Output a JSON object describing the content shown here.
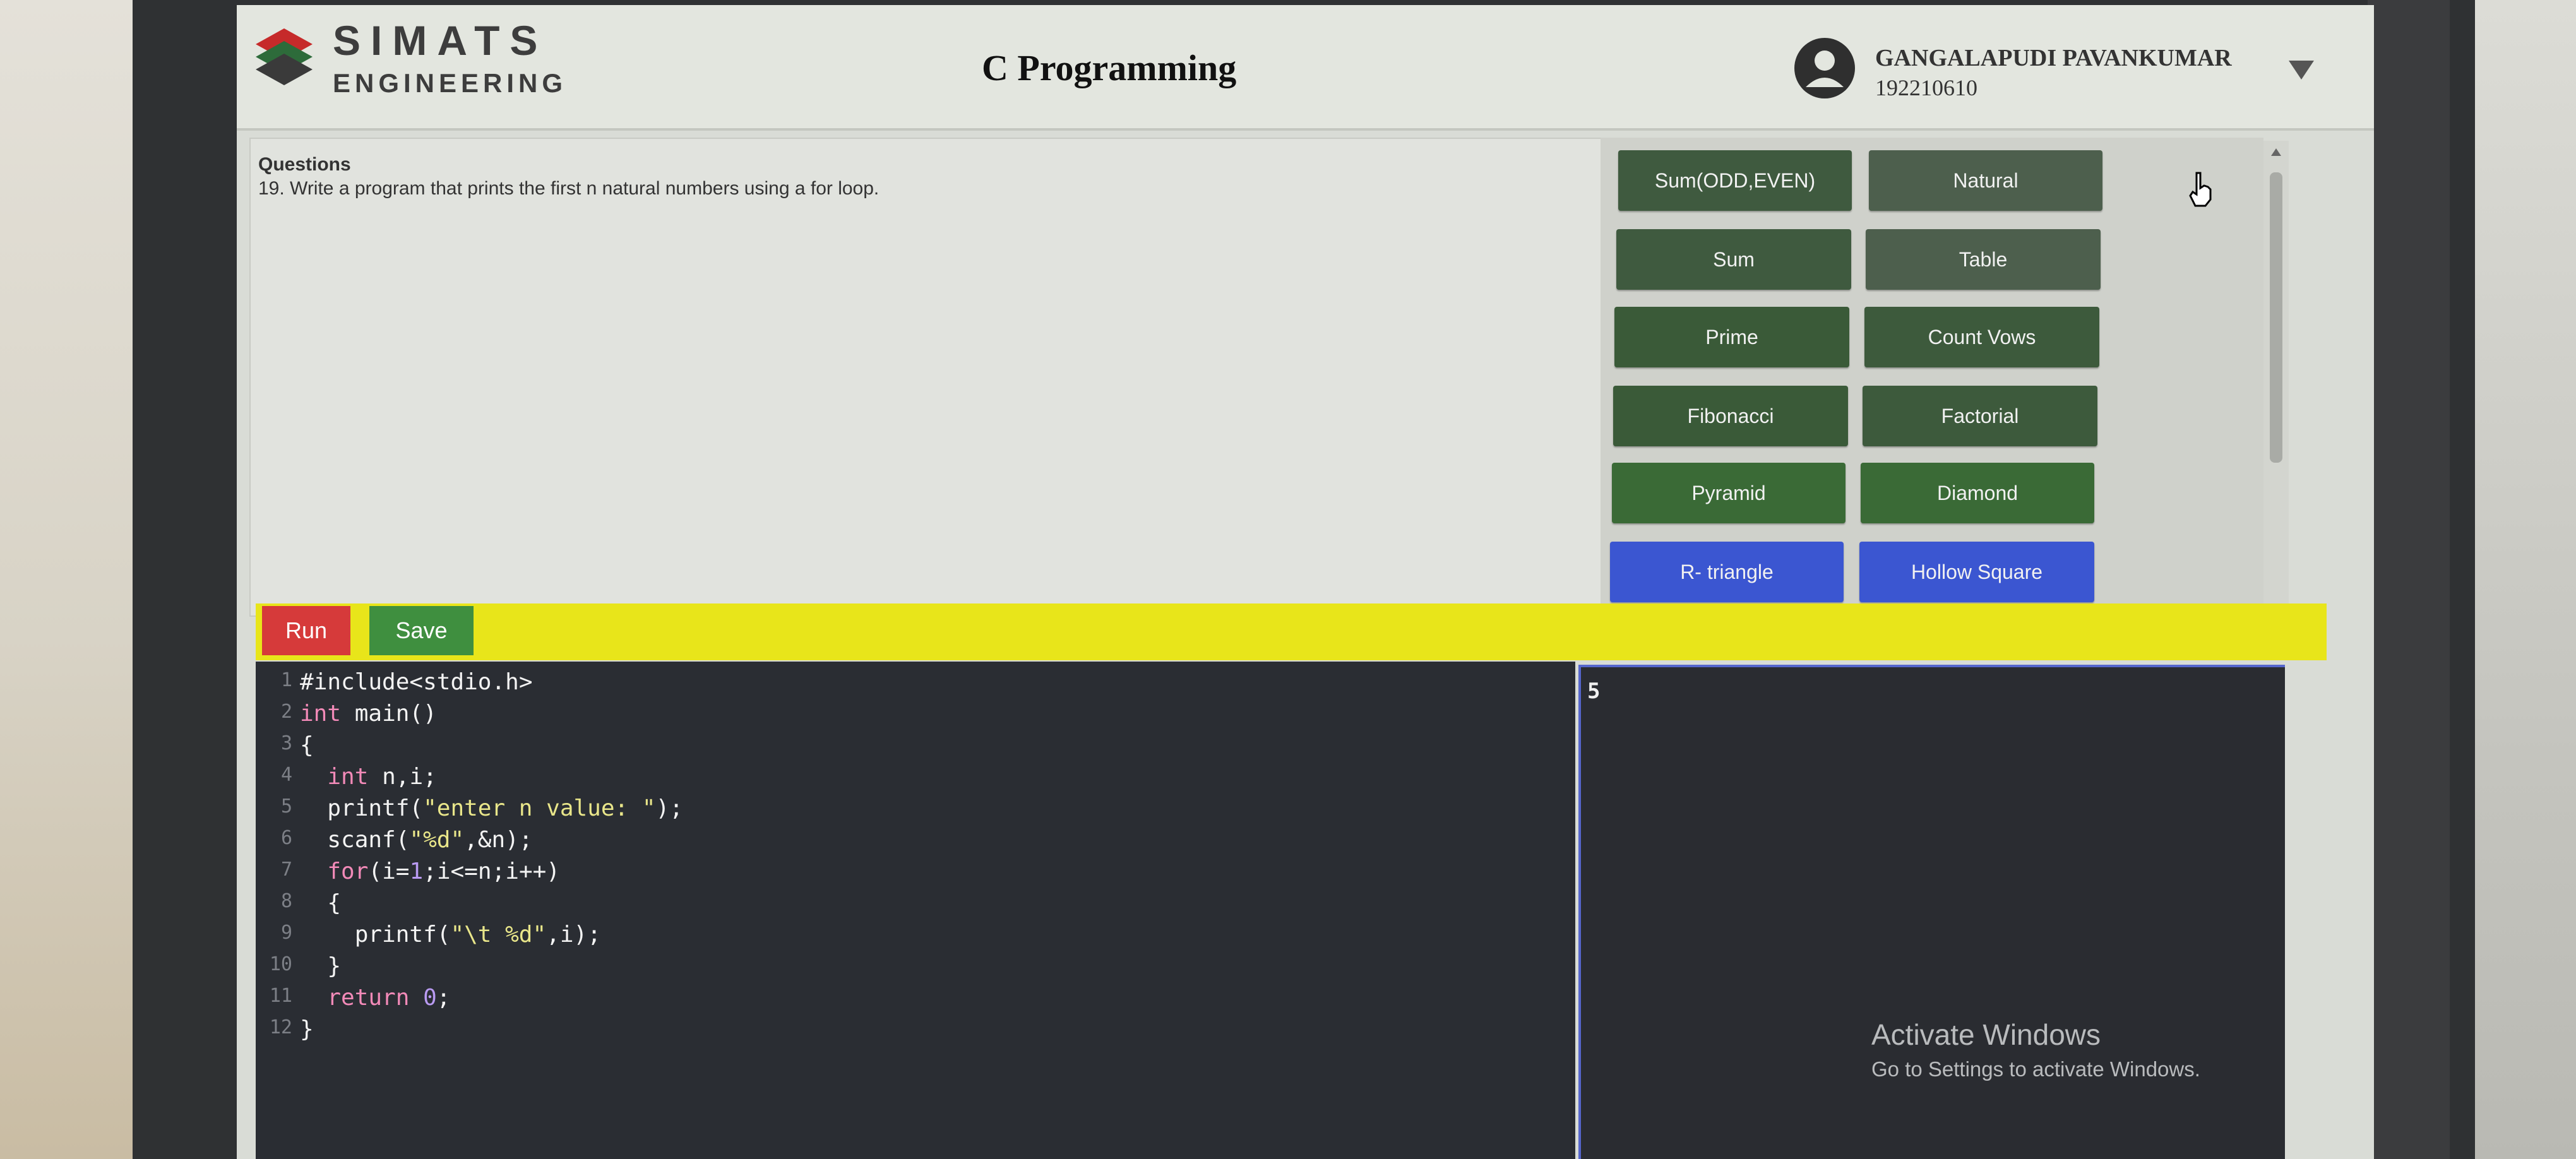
{
  "header": {
    "brand_line1": "SIMATS",
    "brand_line2": "ENGINEERING",
    "title": "C Programming",
    "user_name": "GANGALAPUDI PAVANKUMAR",
    "user_id": "192210610"
  },
  "question": {
    "heading": "Questions",
    "text": "19. Write a program that prints the first n natural numbers using a for loop."
  },
  "topic_buttons": [
    {
      "label": "Sum(ODD,EVEN)",
      "color": "#3f5a3f"
    },
    {
      "label": "Natural",
      "color": "#4d5f4d"
    },
    {
      "label": "Sum",
      "color": "#3f5a3f"
    },
    {
      "label": "Table",
      "color": "#4d5f4d"
    },
    {
      "label": "Prime",
      "color": "#3a5a38"
    },
    {
      "label": "Count Vows",
      "color": "#3d5a3c"
    },
    {
      "label": "Fibonacci",
      "color": "#3a5a38"
    },
    {
      "label": "Factorial",
      "color": "#3d5a3c"
    },
    {
      "label": "Pyramid",
      "color": "#3a6a36"
    },
    {
      "label": "Diamond",
      "color": "#3a6a36"
    },
    {
      "label": "R- triangle",
      "color": "#3b56d1"
    },
    {
      "label": "Hollow Square",
      "color": "#3b56d1"
    }
  ],
  "toolbar": {
    "run_label": "Run",
    "save_label": "Save"
  },
  "code_lines": [
    "#include<stdio.h>",
    "int main()",
    "{",
    "  int n,i;",
    "  printf(\"enter n value: \");",
    "  scanf(\"%d\",&n);",
    "  for(i=1;i<=n;i++)",
    "  {",
    "    printf(\"\\t %d\",i);",
    "  }",
    "  return 0;",
    "}"
  ],
  "output": {
    "text": "5"
  },
  "watermark": {
    "title": "Activate Windows",
    "subtitle": "Go to Settings to activate Windows."
  },
  "colors": {
    "run": "#d63a3a",
    "save": "#3f8f3f",
    "toolbar": "#e8e51a",
    "editor_bg": "#2a2d33"
  }
}
